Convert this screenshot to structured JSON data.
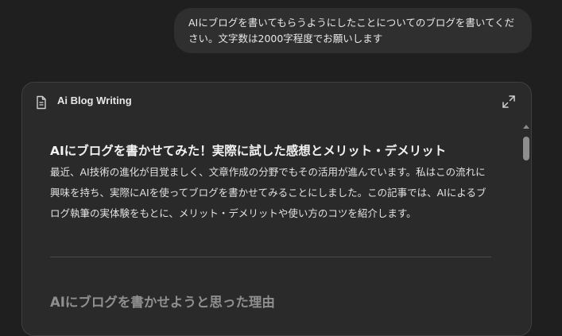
{
  "chat": {
    "user_message": "AIにブログを書いてもらうようにしたことについてのブログを書いてください。文字数は2000字程度でお願いします"
  },
  "canvas": {
    "title": "Ai Blog Writing",
    "document_icon": "document-icon",
    "expand_icon": "expand-icon",
    "heading": "AIにブログを書かせてみた！実際に試した感想とメリット・デメリット",
    "paragraph": "最近、AI技術の進化が目覚ましく、文章作成の分野でもその活用が進んでいます。私はこの流れに興味を持ち、実際にAIを使ってブログを書かせてみることにしました。この記事では、AIによるブログ執筆の実体験をもとに、メリット・デメリットや使い方のコツを紹介します。",
    "subheading": "AIにブログを書かせようと思った理由"
  },
  "colors": {
    "page_background": "#1f1f1f",
    "bubble_background": "#2f2f2f",
    "card_background": "#2a2a2a",
    "card_border": "#3f3f3f",
    "subheading_text": "#8f8f8f"
  }
}
